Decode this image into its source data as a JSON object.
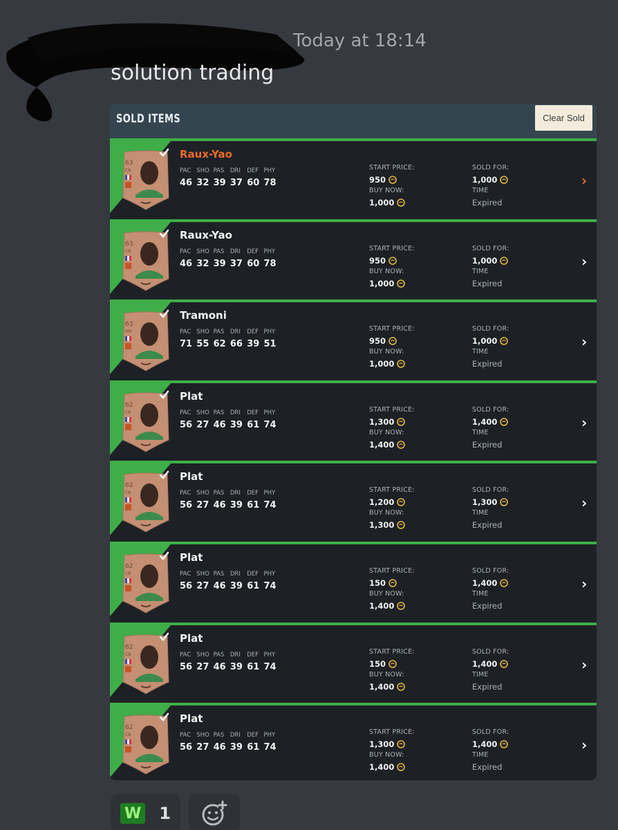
{
  "header": {
    "timestamp": "Today at 18:14",
    "message": "solution trading"
  },
  "panel": {
    "title": "SOLD ITEMS",
    "clear_button": "Clear Sold"
  },
  "labels": {
    "start_price": "START PRICE:",
    "buy_now": "BUY NOW:",
    "sold_for": "SOLD FOR:",
    "time": "TIME",
    "stat_headers": [
      "PAC",
      "SHO",
      "PAS",
      "DRI",
      "DEF",
      "PHY"
    ]
  },
  "colors": {
    "accent_green": "#3fae48",
    "highlight_orange": "#f06a27",
    "card_bronze": "#c48f72"
  },
  "items": [
    {
      "name": "Raux-Yao",
      "rating": "63",
      "position": "CB",
      "stats": [
        "46",
        "32",
        "39",
        "37",
        "60",
        "78"
      ],
      "start_price": "950",
      "buy_now": "1,000",
      "sold_for": "1,000",
      "time": "Expired",
      "selected": true
    },
    {
      "name": "Raux-Yao",
      "rating": "63",
      "position": "CB",
      "stats": [
        "46",
        "32",
        "39",
        "37",
        "60",
        "78"
      ],
      "start_price": "950",
      "buy_now": "1,000",
      "sold_for": "1,000",
      "time": "Expired",
      "selected": false
    },
    {
      "name": "Tramoni",
      "rating": "63",
      "position": "RM",
      "stats": [
        "71",
        "55",
        "62",
        "66",
        "39",
        "51"
      ],
      "start_price": "950",
      "buy_now": "1,000",
      "sold_for": "1,000",
      "time": "Expired",
      "selected": false
    },
    {
      "name": "Plat",
      "rating": "62",
      "position": "CB",
      "stats": [
        "56",
        "27",
        "46",
        "39",
        "61",
        "74"
      ],
      "start_price": "1,300",
      "buy_now": "1,400",
      "sold_for": "1,400",
      "time": "Expired",
      "selected": false
    },
    {
      "name": "Plat",
      "rating": "62",
      "position": "CB",
      "stats": [
        "56",
        "27",
        "46",
        "39",
        "61",
        "74"
      ],
      "start_price": "1,200",
      "buy_now": "1,300",
      "sold_for": "1,300",
      "time": "Expired",
      "selected": false
    },
    {
      "name": "Plat",
      "rating": "62",
      "position": "CB",
      "stats": [
        "56",
        "27",
        "46",
        "39",
        "61",
        "74"
      ],
      "start_price": "150",
      "buy_now": "1,400",
      "sold_for": "1,400",
      "time": "Expired",
      "selected": false
    },
    {
      "name": "Plat",
      "rating": "62",
      "position": "CB",
      "stats": [
        "56",
        "27",
        "46",
        "39",
        "61",
        "74"
      ],
      "start_price": "150",
      "buy_now": "1,400",
      "sold_for": "1,400",
      "time": "Expired",
      "selected": false
    },
    {
      "name": "Plat",
      "rating": "62",
      "position": "CB",
      "stats": [
        "56",
        "27",
        "46",
        "39",
        "61",
        "74"
      ],
      "start_price": "1,300",
      "buy_now": "1,400",
      "sold_for": "1,400",
      "time": "Expired",
      "selected": false
    }
  ],
  "reactions": [
    {
      "emoji": "W",
      "count": "1"
    }
  ],
  "icons": {
    "chevron": "chevron-right-icon",
    "coin": "coin-icon",
    "check": "check-icon",
    "add_reaction": "add-reaction-icon"
  }
}
